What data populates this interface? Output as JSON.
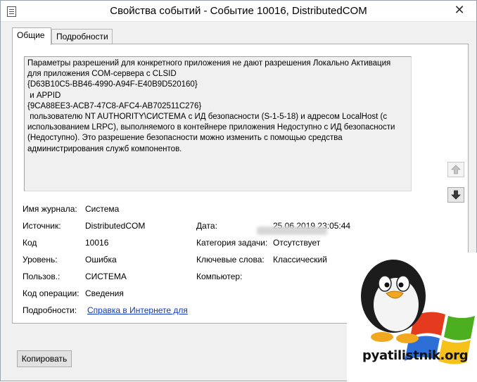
{
  "window": {
    "title": "Свойства событий - Событие 10016, DistributedCOM",
    "close_glyph": "✕"
  },
  "tabs": [
    {
      "label": "Общие",
      "active": true
    },
    {
      "label": "Подробности",
      "active": false
    }
  ],
  "description": "Параметры разрешений для конкретного приложения не дают разрешения Локально Активация\nдля приложения COM-сервера с CLSID\n{D63B10C5-BB46-4990-A94F-E40B9D520160}\n и APPID\n{9CA88EE3-ACB7-47C8-AFC4-AB702511C276}\n пользователю NT AUTHORITY\\СИСТЕМА с ИД безопасности (S-1-5-18) и адресом LocalHost (с\nиспользованием LRPC), выполняемого в контейнере приложения Недоступно с ИД безопасности\n(Недоступно). Это разрешение безопасности можно изменить с помощью средства\nадминистрирования служб компонентов.",
  "fields": {
    "log_name": {
      "label": "Имя журнала:",
      "value": "Система"
    },
    "source": {
      "label": "Источник:",
      "value": "DistributedCOM"
    },
    "event_id": {
      "label": "Код",
      "value": "10016"
    },
    "level": {
      "label": "Уровень:",
      "value": "Ошибка"
    },
    "user": {
      "label": "Пользов.:",
      "value": "СИСТЕМА"
    },
    "opcode": {
      "label": "Код операции:",
      "value": "Сведения"
    },
    "more_info": {
      "label": "Подробности:",
      "value": "Справка в Интернете для"
    },
    "logged": {
      "label": "Дата:",
      "value": "25.06.2019 23:05:44"
    },
    "task_category": {
      "label": "Категория задачи:",
      "value": "Отсутствует"
    },
    "keywords": {
      "label": "Ключевые слова:",
      "value": "Классический"
    },
    "computer": {
      "label": "Компьютер:",
      "value": ""
    }
  },
  "buttons": {
    "copy": "Копировать"
  },
  "watermark": {
    "text": "pyatilistnik.org"
  },
  "colors": {
    "link": "#0a38c4",
    "panel_bg": "#ffffff",
    "window_bg": "#f0f0f0"
  }
}
